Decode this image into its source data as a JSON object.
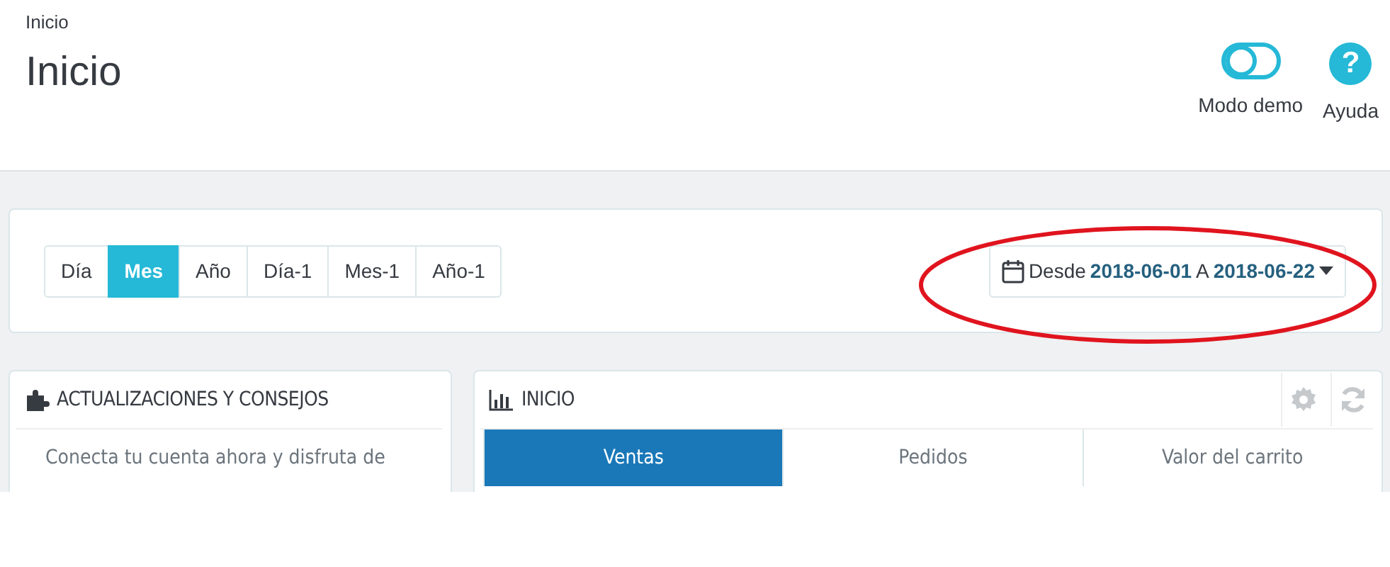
{
  "breadcrumb": "Inicio",
  "title": "Inicio",
  "toolbar": [
    {
      "kind": "toggle",
      "label": "Modo demo",
      "on": false
    },
    {
      "kind": "help",
      "label": "Ayuda",
      "icon": "?"
    }
  ],
  "periods": [
    {
      "label": "Día",
      "selected": false
    },
    {
      "label": "Mes",
      "selected": true
    },
    {
      "label": "Año",
      "selected": false
    },
    {
      "label": "Día-1",
      "selected": false
    },
    {
      "label": "Mes-1",
      "selected": false
    },
    {
      "label": "Año-1",
      "selected": false
    }
  ],
  "date_range": {
    "from_label": "Desde",
    "from": "2018-06-01",
    "to_label": "A",
    "to": "2018-06-22"
  },
  "news_panel": {
    "title": "ACTUALIZACIONES Y CONSEJOS",
    "text": "Conecta tu cuenta ahora y disfruta de"
  },
  "dashboard_panel": {
    "title": "INICIO",
    "tabs": [
      {
        "label": "Ventas",
        "selected": true
      },
      {
        "label": "Pedidos",
        "selected": false
      },
      {
        "label": "Valor del carrito",
        "selected": false
      }
    ]
  }
}
